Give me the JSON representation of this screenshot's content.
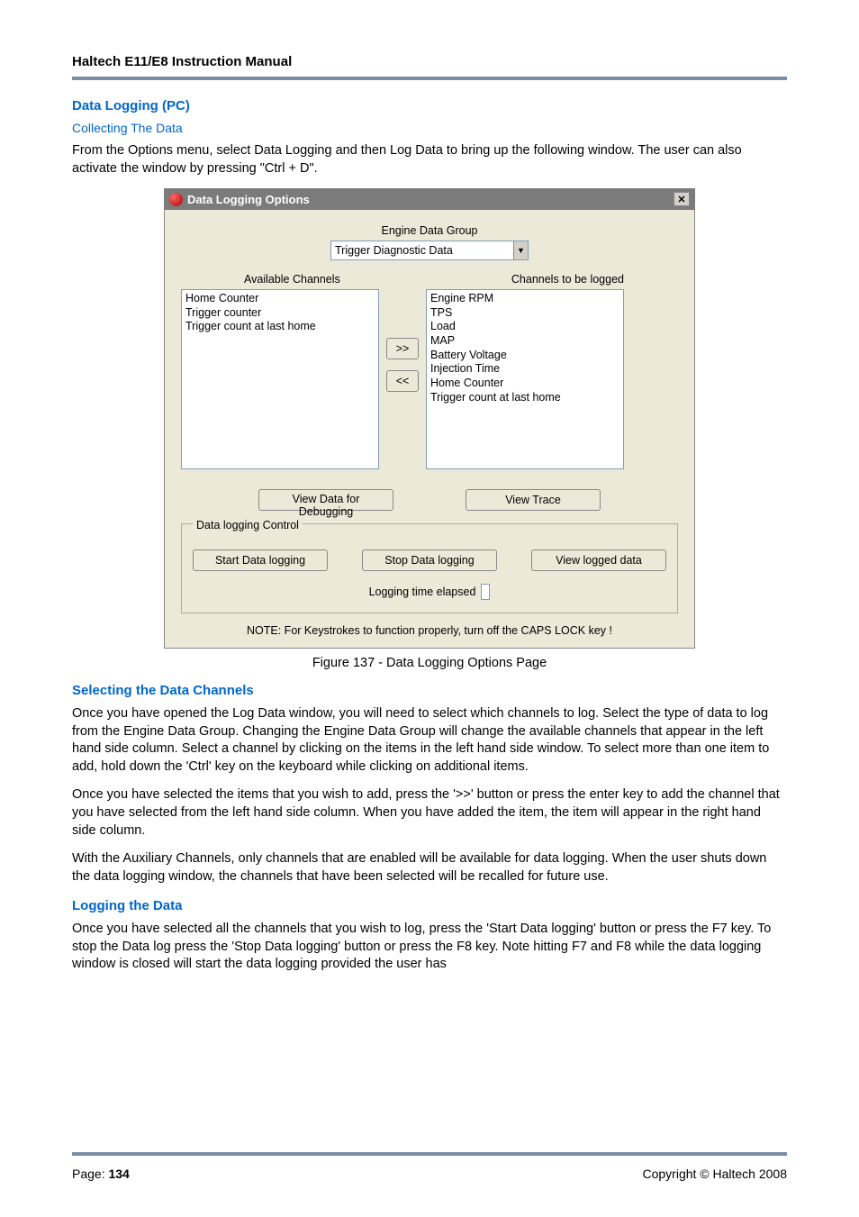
{
  "header": {
    "title": "Haltech E11/E8 Instruction Manual"
  },
  "sections": {
    "data_logging_pc": "Data Logging (PC)",
    "collecting_the_data": "Collecting The Data",
    "intro_para": "From the Options menu, select Data Logging and then Log Data to bring up the following window. The user can also activate the window by pressing \"Ctrl + D\".",
    "selecting_channels": "Selecting the Data Channels",
    "selecting_p1": "Once you have opened the Log Data window, you will need to select which channels to log. Select the type of data to log from the Engine Data Group. Changing the Engine Data Group will change the available channels that appear in the left hand side column. Select a channel by clicking on the items in the left hand side window. To select more than one item to add, hold down the 'Ctrl' key on the keyboard while clicking on additional items.",
    "selecting_p2": "Once you have selected the items that you wish to add, press the '>>' button or press the enter key to add the channel that you have selected from the left hand side column. When you have added the item, the item will appear in the right hand side column.",
    "selecting_p3": "With the Auxiliary Channels, only channels that are enabled will be available for data logging. When the user shuts down the data logging window, the channels that have been selected will be recalled for future use.",
    "logging_the_data": "Logging the Data",
    "logging_p1": "Once you have selected all the channels that you wish to log, press the 'Start Data logging' button or press the F7 key. To stop the Data log press the 'Stop Data logging' button or press the F8 key. Note hitting F7 and F8 while the data logging window is closed will start the data logging provided the user has"
  },
  "dialog": {
    "title": "Data Logging Options",
    "group_label": "Engine Data Group",
    "combo_value": "Trigger Diagnostic Data",
    "available_label": "Available Channels",
    "tolog_label": "Channels to be logged",
    "available_items": [
      "Home Counter",
      "Trigger counter",
      "Trigger count at last home"
    ],
    "logged_items": [
      "Engine RPM",
      "TPS",
      "Load",
      "MAP",
      "Battery Voltage",
      "Injection Time",
      "Home Counter",
      "Trigger count at last home"
    ],
    "add_btn": ">>",
    "remove_btn": "<<",
    "view_debug": "View Data for Debugging",
    "view_trace": "View Trace",
    "fieldset_legend": "Data logging Control",
    "start_btn": "Start Data logging",
    "stop_btn": "Stop Data logging",
    "view_logged": "View logged data",
    "elapsed_label": "Logging time elapsed",
    "note": "NOTE: For Keystrokes to function properly, turn off the CAPS LOCK key !"
  },
  "figure_caption": "Figure 137 - Data Logging Options Page",
  "footer": {
    "page_label": "Page:",
    "page_number": "134",
    "copyright": "Copyright © Haltech 2008"
  }
}
